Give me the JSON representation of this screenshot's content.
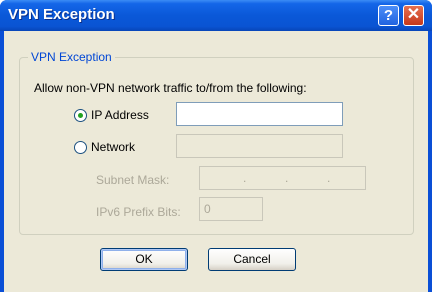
{
  "window": {
    "title": "VPN Exception"
  },
  "titlebar": {
    "help_glyph": "?",
    "close_glyph": "✕"
  },
  "group": {
    "label": "VPN Exception"
  },
  "description": "Allow non-VPN network traffic to/from the following:",
  "options": {
    "ip_address": {
      "label": "IP Address",
      "selected": true,
      "value": ""
    },
    "network": {
      "label": "Network",
      "selected": false,
      "value": ""
    }
  },
  "subnet_mask": {
    "label": "Subnet Mask:",
    "separators": [
      ".",
      ".",
      "."
    ]
  },
  "ipv6_prefix": {
    "label": "IPv6 Prefix Bits:",
    "value": "0"
  },
  "buttons": {
    "ok": "OK",
    "cancel": "Cancel"
  },
  "colors": {
    "title_bar": "#0a58d8",
    "dialog_bg": "#ece9d8",
    "group_label": "#0046d5",
    "radio_dot": "#21a121"
  }
}
